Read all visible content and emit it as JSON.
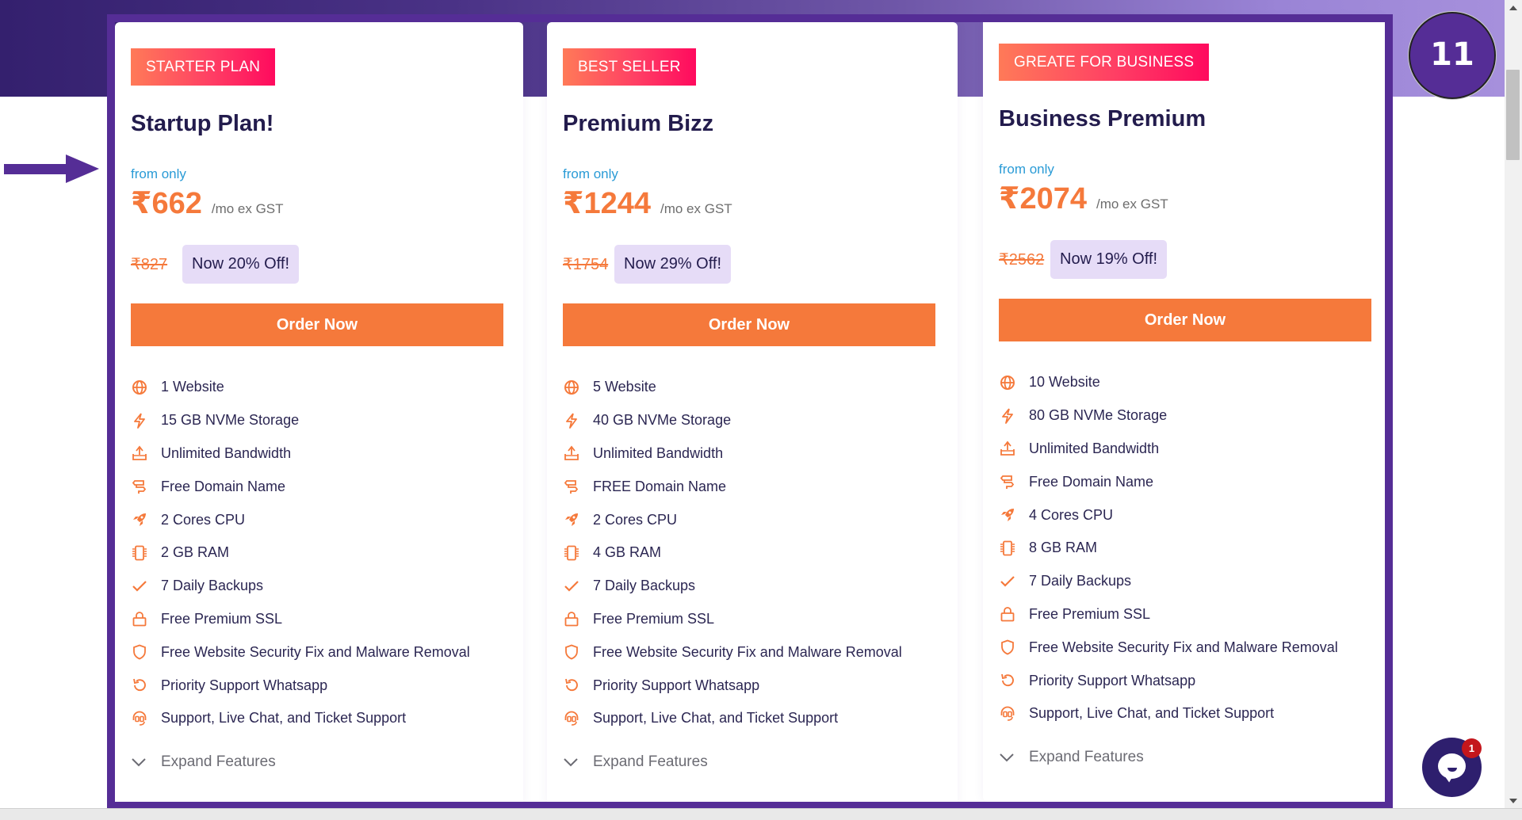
{
  "overlay": {
    "step_number": "11"
  },
  "colors": {
    "accent_orange": "#f5793b",
    "frame_purple": "#552d96",
    "badge_gradient_start": "#ff7a58",
    "badge_gradient_end": "#ff0a5e",
    "discount_bg": "#e6dcf7",
    "from_only_blue": "#2a9bd6"
  },
  "plans": [
    {
      "badge": "STARTER PLAN",
      "title": "Startup Plan!",
      "from_label": "from only",
      "price": "₹662",
      "period": "/mo ex GST",
      "original_price": "₹827",
      "discount": "Now 20% Off!",
      "order_label": "Order Now",
      "features": [
        {
          "icon": "globe-icon",
          "text": "1 Website"
        },
        {
          "icon": "lightning-icon",
          "text": "15 GB NVMe Storage"
        },
        {
          "icon": "upload-tray-icon",
          "text": "Unlimited Bandwidth"
        },
        {
          "icon": "signpost-icon",
          "text": "Free Domain Name"
        },
        {
          "icon": "rocket-icon",
          "text": "2 Cores CPU"
        },
        {
          "icon": "chip-icon",
          "text": "2 GB RAM"
        },
        {
          "icon": "check-icon",
          "text": "7 Daily Backups"
        },
        {
          "icon": "lock-icon",
          "text": "Free Premium SSL"
        },
        {
          "icon": "shield-icon",
          "text": "Free Website Security Fix and Malware Removal"
        },
        {
          "icon": "undo-icon",
          "text": "Priority Support Whatsapp"
        },
        {
          "icon": "headset-icon",
          "text": "Support, Live Chat, and Ticket Support"
        }
      ],
      "expand_label": "Expand Features"
    },
    {
      "badge": "BEST SELLER",
      "title": "Premium Bizz",
      "from_label": "from only",
      "price": "₹1244",
      "period": "/mo ex GST",
      "original_price": "₹1754",
      "discount": "Now 29% Off!",
      "order_label": "Order Now",
      "features": [
        {
          "icon": "globe-icon",
          "text": "5 Website"
        },
        {
          "icon": "lightning-icon",
          "text": "40 GB NVMe Storage"
        },
        {
          "icon": "upload-tray-icon",
          "text": "Unlimited Bandwidth"
        },
        {
          "icon": "signpost-icon",
          "text": "FREE Domain Name"
        },
        {
          "icon": "rocket-icon",
          "text": "2 Cores CPU"
        },
        {
          "icon": "chip-icon",
          "text": "4 GB RAM"
        },
        {
          "icon": "check-icon",
          "text": "7 Daily Backups"
        },
        {
          "icon": "lock-icon",
          "text": "Free Premium SSL"
        },
        {
          "icon": "shield-icon",
          "text": "Free Website Security Fix and Malware Removal"
        },
        {
          "icon": "undo-icon",
          "text": "Priority Support Whatsapp"
        },
        {
          "icon": "headset-icon",
          "text": "Support, Live Chat, and Ticket Support"
        }
      ],
      "expand_label": "Expand Features"
    },
    {
      "badge": "GREATE FOR BUSINESS",
      "title": "Business Premium",
      "from_label": "from only",
      "price": "₹2074",
      "period": "/mo ex GST",
      "original_price": "₹2562",
      "discount": "Now 19% Off!",
      "order_label": "Order Now",
      "features": [
        {
          "icon": "globe-icon",
          "text": "10 Website"
        },
        {
          "icon": "lightning-icon",
          "text": "80 GB NVMe Storage"
        },
        {
          "icon": "upload-tray-icon",
          "text": "Unlimited Bandwidth"
        },
        {
          "icon": "signpost-icon",
          "text": "Free Domain Name"
        },
        {
          "icon": "rocket-icon",
          "text": "4 Cores CPU"
        },
        {
          "icon": "chip-icon",
          "text": "8 GB RAM"
        },
        {
          "icon": "check-icon",
          "text": "7 Daily Backups"
        },
        {
          "icon": "lock-icon",
          "text": "Free Premium SSL"
        },
        {
          "icon": "shield-icon",
          "text": "Free Website Security Fix and Malware Removal"
        },
        {
          "icon": "undo-icon",
          "text": "Priority Support Whatsapp"
        },
        {
          "icon": "headset-icon",
          "text": "Support, Live Chat, and Ticket Support"
        }
      ],
      "expand_label": "Expand Features"
    }
  ],
  "chat": {
    "unread_count": "1"
  }
}
